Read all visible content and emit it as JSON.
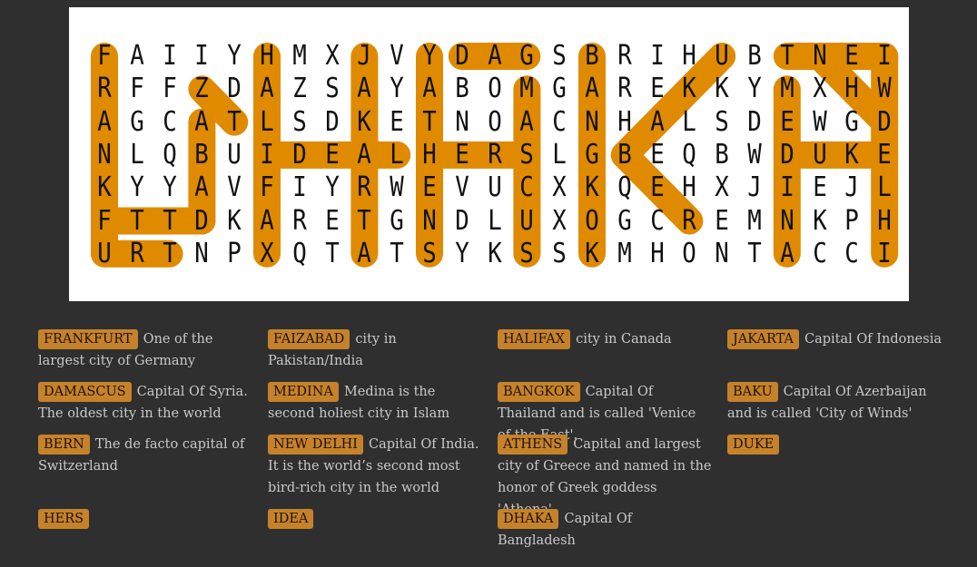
{
  "grid": [
    "FAIIYHMXJVYDAGSBRIHUBTNEI",
    "RFFZDAZSAYABOMGAREKKYMXHW",
    "AGCATLSDKETNOACNHALSDEWGD",
    "NLQBUIDEALHERSLGBEQBWDUKE",
    "KYYAVFIYRWEVUCXKQEHXJIEJL",
    "FTTDKARETGNDLUXOGCREMNKPH",
    "URTNPXQTATSYKSSKMHONTACCI"
  ],
  "highlight_color": "#e08a00",
  "highlights": [
    {
      "word": "FRANKFURT",
      "from": [
        0,
        0
      ],
      "to": [
        6,
        0
      ]
    },
    {
      "word": "URT",
      "from": [
        6,
        0
      ],
      "to": [
        6,
        2
      ]
    },
    {
      "word": "FTTD",
      "from": [
        5,
        0
      ],
      "to": [
        5,
        3
      ]
    },
    {
      "word": "DHAKA-D",
      "from": [
        2,
        3
      ],
      "to": [
        5,
        3
      ]
    },
    {
      "word": "DHAKA-D-top",
      "from": [
        1,
        3
      ],
      "to": [
        2,
        4
      ]
    },
    {
      "word": "HALIFAX",
      "from": [
        0,
        5
      ],
      "to": [
        6,
        5
      ]
    },
    {
      "word": "IDEAL",
      "from": [
        3,
        5
      ],
      "to": [
        3,
        9
      ]
    },
    {
      "word": "JAKARTA",
      "from": [
        0,
        8
      ],
      "to": [
        6,
        8
      ]
    },
    {
      "word": "HERS",
      "from": [
        3,
        10
      ],
      "to": [
        3,
        13
      ]
    },
    {
      "word": "YATS",
      "from": [
        0,
        10
      ],
      "to": [
        6,
        10
      ]
    },
    {
      "word": "DAG",
      "from": [
        0,
        11
      ],
      "to": [
        0,
        13
      ]
    },
    {
      "word": "MSCUS",
      "from": [
        1,
        13
      ],
      "to": [
        6,
        13
      ]
    },
    {
      "word": "BANGKOK",
      "from": [
        0,
        15
      ],
      "to": [
        6,
        15
      ]
    },
    {
      "word": "BAKU",
      "from": [
        3,
        16
      ],
      "to": [
        0,
        19
      ]
    },
    {
      "word": "BQE",
      "from": [
        3,
        16
      ],
      "to": [
        5,
        18
      ]
    },
    {
      "word": "TNEI",
      "from": [
        0,
        21
      ],
      "to": [
        0,
        24
      ]
    },
    {
      "word": "MEDINA",
      "from": [
        1,
        21
      ],
      "to": [
        6,
        21
      ]
    },
    {
      "word": "DUKE",
      "from": [
        3,
        21
      ],
      "to": [
        3,
        24
      ]
    },
    {
      "word": "ATHENS-R",
      "from": [
        0,
        24
      ],
      "to": [
        6,
        24
      ]
    },
    {
      "word": "RIGHT-TOP",
      "from": [
        0,
        22
      ],
      "to": [
        2,
        24
      ]
    }
  ],
  "clues": [
    {
      "word": "FRANKFURT",
      "text": "One of the largest city of Germany"
    },
    {
      "word": "FAIZABAD",
      "text": "city in Pakistan/India"
    },
    {
      "word": "HALIFAX",
      "text": "city in Canada"
    },
    {
      "word": "JAKARTA",
      "text": "Capital Of Indonesia"
    },
    {
      "word": "DAMASCUS",
      "text": "Capital Of Syria. The oldest city in the world"
    },
    {
      "word": "MEDINA",
      "text": "Medina is the second holiest city in Islam"
    },
    {
      "word": "BANGKOK",
      "text": "Capital Of Thailand and is called 'Venice of the East'."
    },
    {
      "word": "BAKU",
      "text": "Capital Of Azerbaijan and is called 'City of Winds'"
    },
    {
      "word": "BERN",
      "text": "The de facto capital of Switzerland"
    },
    {
      "word": "NEW DELHI",
      "text": "Capital Of India. It is the world’s second most bird-rich city in the world"
    },
    {
      "word": "ATHENS",
      "text": "Capital and largest city of Greece and named in the honor of Greek goddess 'Athena'"
    },
    {
      "word": "DUKE",
      "text": ""
    },
    {
      "word": "HERS",
      "text": ""
    },
    {
      "word": "IDEA",
      "text": ""
    },
    {
      "word": "DHAKA",
      "text": "Capital Of Bangladesh"
    }
  ]
}
